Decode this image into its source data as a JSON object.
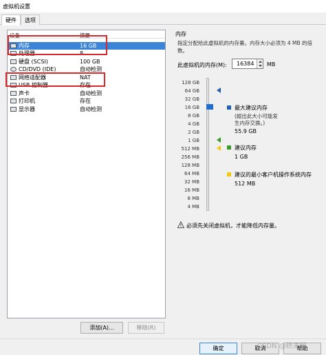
{
  "window": {
    "title": "虚拟机设置"
  },
  "tabs": [
    {
      "label": "硬件",
      "active": true
    },
    {
      "label": "选项",
      "active": false
    }
  ],
  "device_list": {
    "col_device": "设备",
    "col_summary": "摘要",
    "items": [
      {
        "name": "内存",
        "summary": "16 GB",
        "icon": "memory-icon",
        "selected": true
      },
      {
        "name": "处理器",
        "summary": "8",
        "icon": "cpu-icon"
      },
      {
        "name": "硬盘 (SCSI)",
        "summary": "100 GB",
        "icon": "hard-disk-icon"
      },
      {
        "name": "CD/DVD (IDE)",
        "summary": "自动检测",
        "icon": "cd-dvd-icon"
      },
      {
        "name": "网络适配器",
        "summary": "NAT",
        "icon": "network-adapter-icon"
      },
      {
        "name": "USB 控制器",
        "summary": "存在",
        "icon": "usb-icon"
      },
      {
        "name": "声卡",
        "summary": "自动检测",
        "icon": "sound-card-icon"
      },
      {
        "name": "打印机",
        "summary": "存在",
        "icon": "printer-icon"
      },
      {
        "name": "显示器",
        "summary": "自动检测",
        "icon": "monitor-icon"
      }
    ],
    "add_label": "添加(A)...",
    "remove_label": "移除(R)"
  },
  "memory": {
    "section_title": "内存",
    "description": "指定分配给此虚拟机的内存量。内存大小必须为 4 MB 的倍数。",
    "input_label": "此虚拟机的内存(M):",
    "value": "16384",
    "unit": "MB",
    "scale_labels": [
      "128 GB",
      "64 GB",
      "32 GB",
      "16 GB",
      "8 GB",
      "4 GB",
      "2 GB",
      "1 GB",
      "512 MB",
      "256 MB",
      "128 MB",
      "64 MB",
      "32 MB",
      "16 MB",
      "8 MB",
      "4 MB"
    ],
    "max_recommended": {
      "title": "最大建议内存",
      "note": "(超出此大小可能发生内存交换。)",
      "value": "55.9 GB",
      "color": "#1f5fad"
    },
    "recommended": {
      "title": "建议内存",
      "value": "1 GB",
      "color": "#3a9a2a"
    },
    "min_guest": {
      "title": "建议的最小客户机操作系统内存",
      "value": "512 MB",
      "color": "#f2c811"
    },
    "warning": "必须先关闭虚拟机，才能降低内存量。"
  },
  "footer": {
    "ok_label": "确定",
    "cancel_label": "取消",
    "help_label": "帮助",
    "watermark": "CSDN @终末解"
  }
}
